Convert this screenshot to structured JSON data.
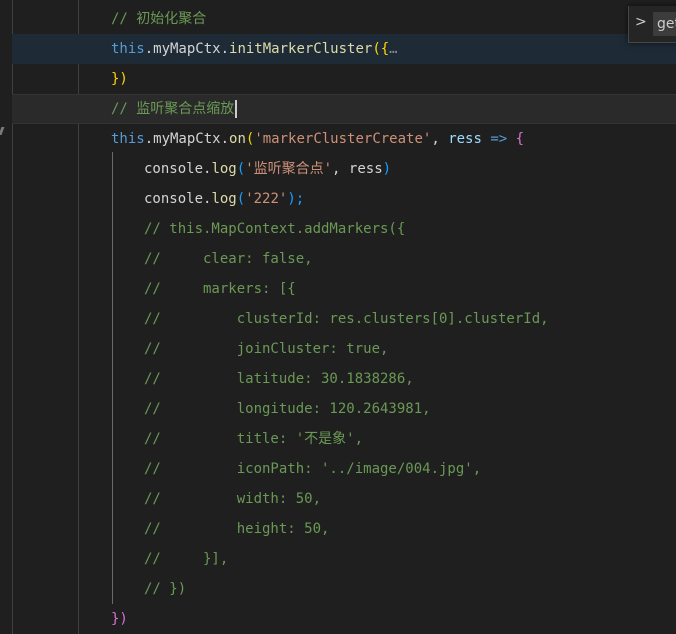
{
  "lines": [
    {
      "id": "l1",
      "text": "// 初始化聚合"
    },
    {
      "id": "l2a",
      "text": "this"
    },
    {
      "id": "l2b",
      "text": ".myMapCtx."
    },
    {
      "id": "l2c",
      "text": "initMarkerCluster"
    },
    {
      "id": "l2d",
      "text": "({"
    },
    {
      "id": "l2e",
      "text": "…"
    },
    {
      "id": "l3",
      "text": "})"
    },
    {
      "id": "l4",
      "text": "// 监听聚合点缩放"
    },
    {
      "id": "l5a",
      "text": "this"
    },
    {
      "id": "l5b",
      "text": ".myMapCtx."
    },
    {
      "id": "l5c",
      "text": "on"
    },
    {
      "id": "l5d",
      "text": "("
    },
    {
      "id": "l5e",
      "text": "'markerClusterCreate'"
    },
    {
      "id": "l5f",
      "text": ", "
    },
    {
      "id": "l5g",
      "text": "ress"
    },
    {
      "id": "l5h",
      "text": " => "
    },
    {
      "id": "l5i",
      "text": "{"
    },
    {
      "id": "l6a",
      "text": "console"
    },
    {
      "id": "l6b",
      "text": "."
    },
    {
      "id": "l6c",
      "text": "log"
    },
    {
      "id": "l6d",
      "text": "("
    },
    {
      "id": "l6e",
      "text": "'监听聚合点'"
    },
    {
      "id": "l6f",
      "text": ", "
    },
    {
      "id": "l6g",
      "text": "ress"
    },
    {
      "id": "l6h",
      "text": ")"
    },
    {
      "id": "l7a",
      "text": "console"
    },
    {
      "id": "l7b",
      "text": "."
    },
    {
      "id": "l7c",
      "text": "log"
    },
    {
      "id": "l7d",
      "text": "("
    },
    {
      "id": "l7e",
      "text": "'222'"
    },
    {
      "id": "l7f",
      "text": ");"
    },
    {
      "id": "l8",
      "text": "// this.MapContext.addMarkers({"
    },
    {
      "id": "l9",
      "text": "//     clear: false,"
    },
    {
      "id": "l10",
      "text": "//     markers: [{"
    },
    {
      "id": "l11",
      "text": "//         clusterId: res.clusters[0].clusterId,"
    },
    {
      "id": "l12",
      "text": "//         joinCluster: true,"
    },
    {
      "id": "l13",
      "text": "//         latitude: 30.1838286,"
    },
    {
      "id": "l14",
      "text": "//         longitude: 120.2643981,"
    },
    {
      "id": "l15",
      "text": "//         title: '不是象',"
    },
    {
      "id": "l16",
      "text": "//         iconPath: '../image/004.jpg',"
    },
    {
      "id": "l17",
      "text": "//         width: 50,"
    },
    {
      "id": "l18",
      "text": "//         height: 50,"
    },
    {
      "id": "l19",
      "text": "//     }],"
    },
    {
      "id": "l20",
      "text": "// })"
    },
    {
      "id": "l21",
      "text": "})"
    }
  ],
  "suggest": {
    "chevron": ">",
    "input_value": "get"
  },
  "colors": {
    "background": "#1f1f1f",
    "keyword": "#569cd6",
    "function": "#dcdcaa",
    "string": "#ce9178",
    "comment": "#6a9955",
    "variable": "#9cdcfe"
  }
}
